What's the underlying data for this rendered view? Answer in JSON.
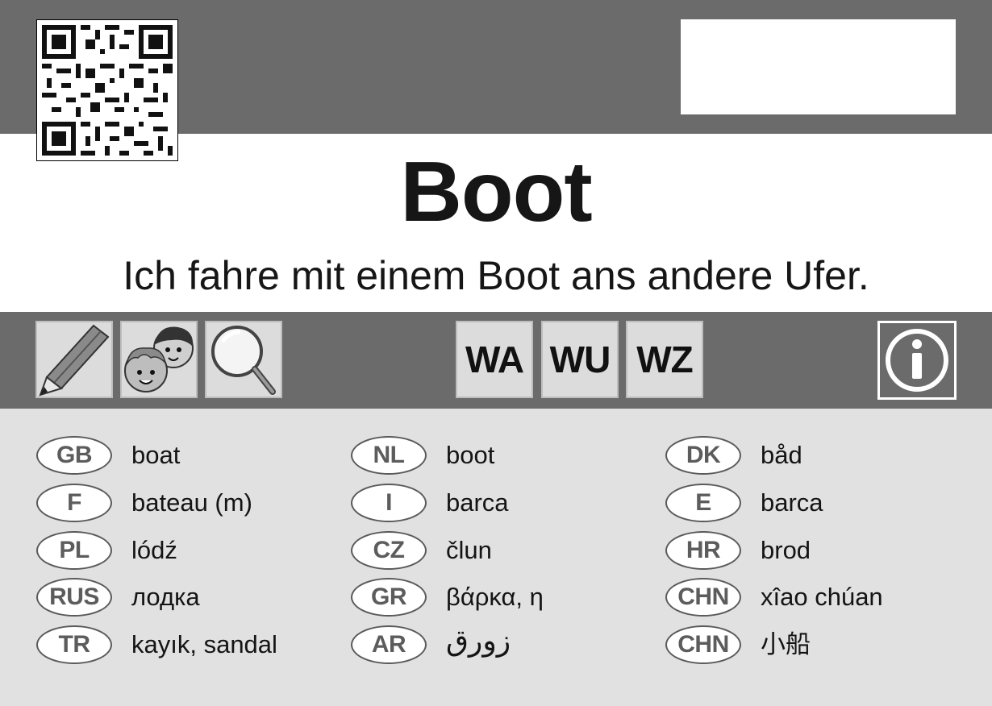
{
  "card": {
    "title": "Boot",
    "sentence": "Ich fahre mit einem Boot ans andere Ufer."
  },
  "header": {
    "qr_icon": "qr-code-icon",
    "name_box_value": ""
  },
  "toolbar": {
    "tools": [
      {
        "name": "pencil",
        "icon": "pencil-icon"
      },
      {
        "name": "children",
        "icon": "children-faces-icon"
      },
      {
        "name": "magnifier",
        "icon": "magnifier-icon"
      }
    ],
    "word_buttons": [
      "WA",
      "WU",
      "WZ"
    ],
    "info_icon": "info-icon"
  },
  "translations": [
    {
      "code": "GB",
      "word": "boat"
    },
    {
      "code": "F",
      "word": "bateau (m)"
    },
    {
      "code": "PL",
      "word": "lódź"
    },
    {
      "code": "RUS",
      "word": "лодка"
    },
    {
      "code": "TR",
      "word": "kayık, sandal"
    },
    {
      "code": "NL",
      "word": "boot"
    },
    {
      "code": "I",
      "word": "barca"
    },
    {
      "code": "CZ",
      "word": "člun"
    },
    {
      "code": "GR",
      "word": "βάρκα, η"
    },
    {
      "code": "AR",
      "word": "زورق"
    },
    {
      "code": "DK",
      "word": "båd"
    },
    {
      "code": "E",
      "word": "barca"
    },
    {
      "code": "HR",
      "word": "brod"
    },
    {
      "code": "CHN",
      "word": "xîao chúan"
    },
    {
      "code": "CHN",
      "word": "小船"
    }
  ],
  "colors": {
    "band": "#6b6b6b",
    "panel": "#e1e1e1",
    "tile": "#dcdcdc",
    "badge_text": "#5c5c5c"
  }
}
